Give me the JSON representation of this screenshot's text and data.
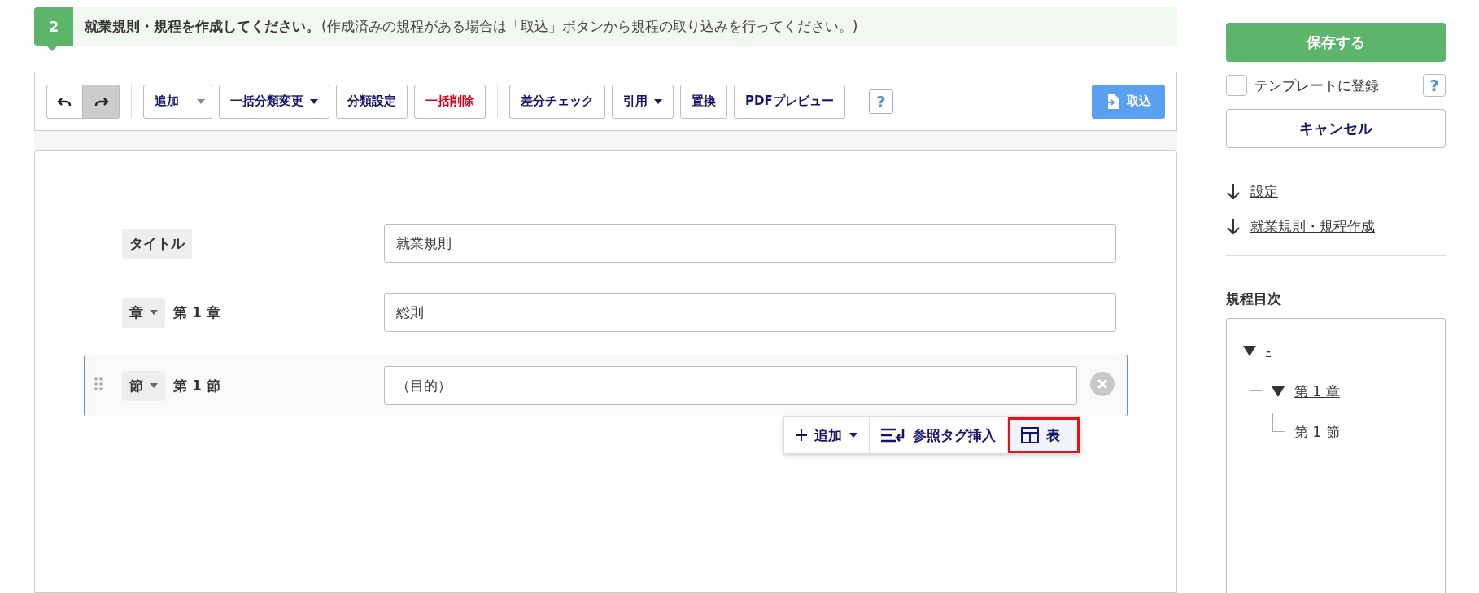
{
  "step": {
    "number": "2",
    "title": "就業規則・規程を作成してください。",
    "note": "(作成済みの規程がある場合は「取込」ボタンから規程の取り込みを行ってください。)"
  },
  "toolbar": {
    "history": [
      {
        "kind": "undo",
        "pressed": false
      },
      {
        "kind": "redo",
        "pressed": true
      }
    ],
    "groups": [
      [
        {
          "label": "追加",
          "kind": "split"
        },
        {
          "label": "一括分類変更",
          "kind": "dropdown"
        },
        {
          "label": "分類設定",
          "kind": "plain"
        },
        {
          "label": "一括削除",
          "kind": "danger"
        }
      ],
      [
        {
          "label": "差分チェック",
          "kind": "plain"
        },
        {
          "label": "引用",
          "kind": "dropdown"
        },
        {
          "label": "置換",
          "kind": "plain"
        },
        {
          "label": "PDFプレビュー",
          "kind": "plain"
        }
      ]
    ],
    "help": "?",
    "import_button": "取込"
  },
  "rows": [
    {
      "kind": "title",
      "tag": "タイトル",
      "value": "就業規則",
      "selected": false
    },
    {
      "kind": "heading",
      "tag": "章",
      "number": "第 1 章",
      "value": "総則",
      "selected": false
    },
    {
      "kind": "heading",
      "tag": "節",
      "number": "第 1 節",
      "value": "（目的）",
      "selected": true
    }
  ],
  "popup": [
    {
      "kind": "add",
      "label": "追加",
      "highlighted": false
    },
    {
      "kind": "tag",
      "label": "参照タグ挿入",
      "highlighted": false
    },
    {
      "kind": "table",
      "label": "表",
      "highlighted": true
    }
  ],
  "sidebar": {
    "save_button": "保存する",
    "template": {
      "label": "テンプレートに登録",
      "checked": false
    },
    "help": "?",
    "cancel_button": "キャンセル",
    "links": [
      "設定",
      "就業規則・規程作成"
    ],
    "toc_title": "規程目次",
    "toc": [
      {
        "label": "-",
        "expanded": true,
        "children": [
          {
            "label": "第 1 章",
            "expanded": true,
            "children": [
              {
                "label": "第 1 節"
              }
            ]
          }
        ]
      }
    ]
  }
}
